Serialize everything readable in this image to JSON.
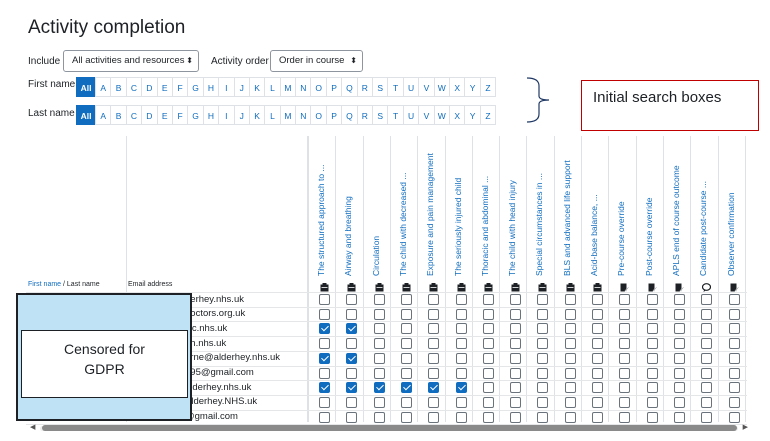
{
  "page": {
    "title": "Activity completion"
  },
  "filters": {
    "include_label": "Include",
    "include_value": "All activities and resources",
    "order_label": "Activity order",
    "order_value": "Order in course"
  },
  "initials": {
    "first_label": "First name",
    "last_label": "Last name",
    "all_label": "All",
    "letters": [
      "A",
      "B",
      "C",
      "D",
      "E",
      "F",
      "G",
      "H",
      "I",
      "J",
      "K",
      "L",
      "M",
      "N",
      "O",
      "P",
      "Q",
      "R",
      "S",
      "T",
      "U",
      "V",
      "W",
      "X",
      "Y",
      "Z"
    ]
  },
  "annotation": {
    "callout_text": "Initial search boxes",
    "censor_line1": "Censored for",
    "censor_line2": "GDPR"
  },
  "table": {
    "first_name_header": "First name",
    "separator": " / ",
    "last_name_header": "Last name",
    "email_header": "Email address",
    "activities": [
      {
        "name": "The structured approach to ...",
        "icon": "assignment-icon"
      },
      {
        "name": "Airway and breathing",
        "icon": "assignment-icon"
      },
      {
        "name": "Circulation",
        "icon": "assignment-icon"
      },
      {
        "name": "The child with decreased ...",
        "icon": "assignment-icon"
      },
      {
        "name": "Exposure and pain management",
        "icon": "assignment-icon"
      },
      {
        "name": "The seriously injured child",
        "icon": "assignment-icon"
      },
      {
        "name": "Thoracic and abdominal ...",
        "icon": "assignment-icon"
      },
      {
        "name": "The child with head injury",
        "icon": "assignment-icon"
      },
      {
        "name": "Special circumstances in ...",
        "icon": "assignment-icon"
      },
      {
        "name": "BLS and advanced life support",
        "icon": "assignment-icon"
      },
      {
        "name": "Acid-base balance, ...",
        "icon": "assignment-icon"
      },
      {
        "name": "Pre-course override",
        "icon": "edit-icon"
      },
      {
        "name": "Post-course override",
        "icon": "edit-icon"
      },
      {
        "name": "APLS end of course outcome",
        "icon": "edit-icon"
      },
      {
        "name": "Candidate post-course ...",
        "icon": "feedback-icon"
      },
      {
        "name": "Observer confirmation",
        "icon": "edit-icon"
      }
    ],
    "rows": [
      {
        "email": "derhey.nhs.uk",
        "checks": [
          0,
          0,
          0,
          0,
          0,
          0,
          0,
          0,
          0,
          0,
          0,
          0,
          0,
          0,
          0,
          0
        ]
      },
      {
        "email": "doctors.org.uk",
        "checks": [
          0,
          0,
          0,
          0,
          0,
          0,
          0,
          0,
          0,
          0,
          0,
          0,
          0,
          0,
          0,
          0
        ]
      },
      {
        "email": "cic.nhs.uk",
        "checks": [
          1,
          1,
          0,
          0,
          0,
          0,
          0,
          0,
          0,
          0,
          0,
          0,
          0,
          0,
          0,
          0
        ]
      },
      {
        "email": "gh.nhs.uk",
        "checks": [
          0,
          0,
          0,
          0,
          0,
          0,
          0,
          0,
          0,
          0,
          0,
          0,
          0,
          0,
          0,
          0
        ]
      },
      {
        "email": "urne@alderhey.nhs.uk",
        "checks": [
          1,
          1,
          0,
          0,
          0,
          0,
          0,
          0,
          0,
          0,
          0,
          0,
          0,
          0,
          0,
          0
        ]
      },
      {
        "email": "995@gmail.com",
        "checks": [
          0,
          0,
          0,
          0,
          0,
          0,
          0,
          0,
          0,
          0,
          0,
          0,
          0,
          0,
          0,
          0
        ]
      },
      {
        "email": "alderhey.nhs.uk",
        "checks": [
          1,
          1,
          1,
          1,
          1,
          1,
          0,
          0,
          0,
          0,
          0,
          0,
          0,
          0,
          0,
          0
        ]
      },
      {
        "email": "Alderhey.NHS.uk",
        "checks": [
          0,
          0,
          0,
          0,
          0,
          0,
          0,
          0,
          0,
          0,
          0,
          0,
          0,
          0,
          0,
          0
        ]
      },
      {
        "email": "@gmail.com",
        "checks": [
          0,
          0,
          0,
          0,
          0,
          0,
          0,
          0,
          0,
          0,
          0,
          0,
          0,
          0,
          0,
          0
        ]
      }
    ]
  },
  "colors": {
    "link": "#0f6cbf",
    "callout_border": "#c00000",
    "censor_fill": "#bfe3f5"
  }
}
